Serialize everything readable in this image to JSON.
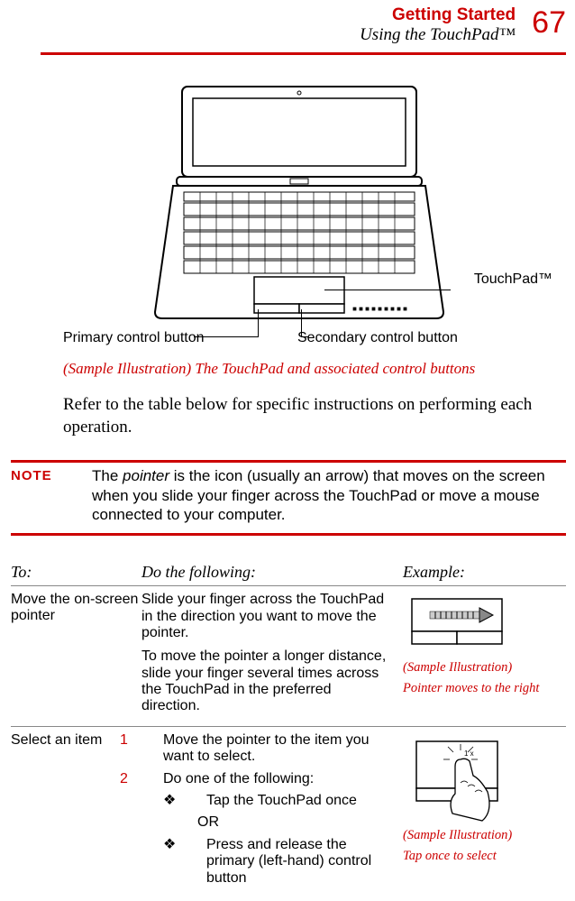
{
  "header": {
    "chapter": "Getting Started",
    "section": "Using the TouchPad™",
    "page": "67"
  },
  "figure": {
    "callouts": {
      "touchpad": "TouchPad™",
      "primary": "Primary control button",
      "secondary": "Secondary control button"
    },
    "caption": "(Sample Illustration) The TouchPad and associated control buttons"
  },
  "intro": "Refer to the table below for specific instructions on performing each operation.",
  "note": {
    "label": "NOTE",
    "text_before": "The ",
    "term": "pointer",
    "text_after": " is the icon (usually an arrow) that moves on the screen when you slide your finger across the TouchPad or move a mouse connected to your computer."
  },
  "table": {
    "headers": {
      "to": "To:",
      "do": "Do the following:",
      "example": "Example:"
    },
    "rows": [
      {
        "to": "Move the on-screen pointer",
        "do_p1": "Slide your finger across the TouchPad in the direction you want to move the pointer.",
        "do_p2": "To move the pointer a longer distance, slide your finger several times across the TouchPad in the preferred direction.",
        "ex_title": "(Sample Illustration)",
        "ex_sub": "Pointer moves to the right"
      },
      {
        "to": "Select an item",
        "step1_num": "1",
        "step1": "Move the pointer to the item you want to select.",
        "step2_num": "2",
        "step2": "Do one of the following:",
        "bullet1_sym": "❖",
        "bullet1": "Tap the TouchPad once",
        "or": "OR",
        "bullet2_sym": "❖",
        "bullet2": "Press and release the primary (left-hand) control button",
        "ex_title": "(Sample Illustration)",
        "ex_sub": "Tap once to select"
      }
    ]
  }
}
